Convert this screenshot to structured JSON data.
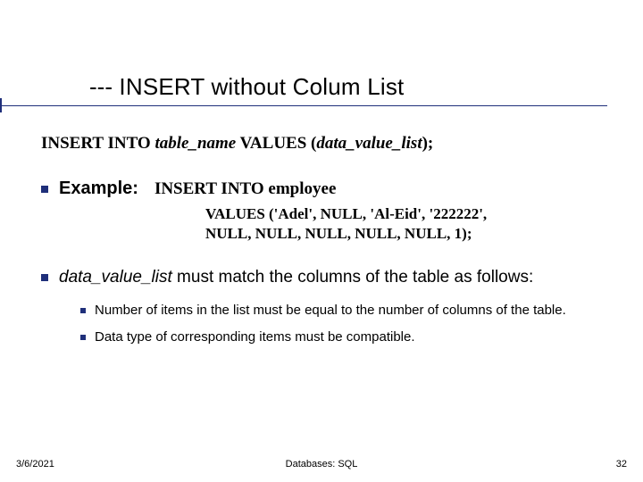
{
  "title": {
    "dashes": "---",
    "text": "INSERT without Colum List"
  },
  "syntax": {
    "prefix": "INSERT INTO ",
    "table_name": "table_name",
    "mid": "   VALUES (",
    "data_value_list": "data_value_list",
    "suffix": ");"
  },
  "example": {
    "label": "Example:",
    "line1": "INSERT INTO employee",
    "line2": "VALUES ('Adel', NULL, 'Al-Eid', '222222',",
    "line3": "NULL, NULL, NULL, NULL, NULL, 1);"
  },
  "para": {
    "ital": "data_value_list",
    "rest": " must match the columns of the table as follows:"
  },
  "sub": {
    "s1": "Number of items in the list must be equal to the number of columns of the table.",
    "s2": "Data type of corresponding items must  be compatible."
  },
  "footer": {
    "left": "3/6/2021",
    "center": "Databases: SQL",
    "right": "32"
  }
}
